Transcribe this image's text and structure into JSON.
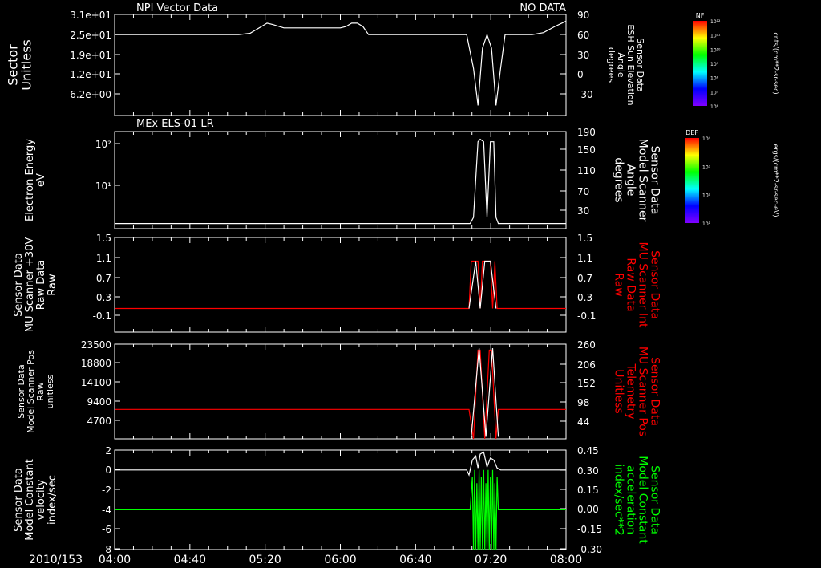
{
  "page": {
    "date_label": "2010/153",
    "time_ticks": [
      "04:00",
      "04:40",
      "05:20",
      "06:00",
      "06:40",
      "07:20",
      "08:00"
    ],
    "time_range_hours": [
      4.0,
      8.0
    ]
  },
  "colors": {
    "background": "#000000",
    "axis": "#ffffff",
    "trace_white": "#ffffff",
    "trace_red": "#ff0000",
    "trace_green": "#00ff00"
  },
  "colorbars": [
    {
      "name": "NF",
      "units": "cnts/(cm**2-sr-sec)",
      "ticks": [
        "10¹²",
        "10¹¹",
        "10¹⁰",
        "10⁹",
        "10⁸",
        "10⁷",
        "10⁶"
      ]
    },
    {
      "name": "DEF",
      "units": "ergs/(cm**2-sr-sec-eV)",
      "ticks": [
        "10⁴",
        "10³",
        "10²",
        "10¹"
      ]
    }
  ],
  "chart_data": [
    {
      "type": "line",
      "header_left": "NPI Vector Data",
      "header_right": "NO DATA",
      "ylabel": [
        "Sector",
        "Unitless"
      ],
      "yticks_left": [
        "3.1e+01",
        "2.5e+01",
        "1.9e+01",
        "1.2e+01",
        "6.2e+00"
      ],
      "right_label_color": "#ffffff",
      "ylabel_right": [
        "Sensor Data",
        "ESH Sun Elevation",
        "Angle",
        "degrees"
      ],
      "yticks_right": [
        "90",
        "60",
        "30",
        "0",
        "-30"
      ],
      "ylim_right": [
        -60,
        90
      ],
      "series": [
        {
          "color": "#ffffff",
          "x": [
            4.0,
            5.0,
            5.1,
            5.2,
            5.3,
            5.35,
            5.4,
            5.5,
            5.75,
            5.8,
            5.9,
            6.0,
            6.05,
            6.1,
            6.15,
            6.2,
            6.25,
            7.0,
            7.12,
            7.18,
            7.22,
            7.26,
            7.3,
            7.34,
            7.38,
            7.42,
            7.46,
            7.5,
            7.7,
            7.8,
            7.9,
            8.0
          ],
          "y": [
            60,
            60,
            60,
            62,
            72,
            77,
            75,
            70,
            70,
            70,
            70,
            70,
            72,
            77,
            77,
            72,
            60,
            60,
            60,
            10,
            -45,
            40,
            60,
            40,
            -45,
            10,
            60,
            60,
            60,
            63,
            72,
            80
          ]
        }
      ]
    },
    {
      "type": "line",
      "header_left": "MEx ELS-01 LR",
      "ylabel": [
        "Electron Energy",
        "eV"
      ],
      "yticks_left": [
        "10²",
        "10¹"
      ],
      "right_label_color": "#ffffff",
      "ylabel_right": [
        "Sensor Data",
        "Model Scanner",
        "Angle",
        "degrees"
      ],
      "yticks_right": [
        "190",
        "150",
        "110",
        "70",
        "30"
      ],
      "ylim_right": [
        10,
        190
      ],
      "series": [
        {
          "color": "#ffffff",
          "x": [
            4.0,
            7.15,
            7.18,
            7.22,
            7.24,
            7.27,
            7.3,
            7.33,
            7.36,
            7.38,
            7.4,
            8.0
          ],
          "y": [
            10,
            10,
            22,
            170,
            175,
            170,
            22,
            170,
            170,
            22,
            10,
            10
          ]
        }
      ]
    },
    {
      "type": "line",
      "ylabel": [
        "Sensor Data",
        "MU Scanner +30V",
        "Raw Data",
        "Raw"
      ],
      "yticks_left": [
        "1.5",
        "1.1",
        "0.7",
        "0.3",
        "-0.1"
      ],
      "ylim_left": [
        -0.5,
        1.5
      ],
      "right_label_color": "#ff0000",
      "ylabel_right": [
        "Sensor Data",
        "MU Scanner Int",
        "Raw Data",
        "Raw"
      ],
      "yticks_right": [
        "1.5",
        "1.1",
        "0.7",
        "0.3",
        "-0.1"
      ],
      "series": [
        {
          "color": "#ff0000",
          "x": [
            4.0,
            7.14,
            7.16,
            7.22,
            7.24,
            7.26,
            7.28,
            7.33,
            7.35,
            7.37,
            7.39,
            8.0
          ],
          "y": [
            0.0,
            0.0,
            1.0,
            1.0,
            0.0,
            1.0,
            1.0,
            1.0,
            0.0,
            1.0,
            0.0,
            0.0
          ]
        },
        {
          "color": "#ffffff",
          "x": [
            7.14,
            7.2,
            7.24,
            7.28,
            7.33,
            7.38
          ],
          "y": [
            0.0,
            1.0,
            0.0,
            1.0,
            1.0,
            0.0
          ]
        }
      ]
    },
    {
      "type": "line",
      "ylabel": [
        "Sensor Data",
        "Model Scanner Pos",
        "Raw",
        "unitless"
      ],
      "yticks_left": [
        "23500",
        "18800",
        "14100",
        "9400",
        "4700"
      ],
      "ylim_left": [
        0,
        23500
      ],
      "right_label_color": "#ff0000",
      "ylabel_right": [
        "Sensor Data",
        "MU Scanner Pos",
        "Telemetry",
        "Unitless"
      ],
      "yticks_right": [
        "260",
        "206",
        "152",
        "98",
        "44"
      ],
      "series": [
        {
          "color": "#ff0000",
          "x": [
            4.0,
            7.14,
            7.18,
            7.22,
            7.24,
            7.28,
            7.32,
            7.34,
            7.38,
            7.4,
            8.0
          ],
          "y": [
            7300,
            7300,
            0,
            22000,
            22000,
            0,
            22000,
            22000,
            0,
            7300,
            7300
          ]
        },
        {
          "color": "#ffffff",
          "x": [
            7.16,
            7.23,
            7.29,
            7.35,
            7.4
          ],
          "y": [
            500,
            22500,
            500,
            22500,
            500
          ]
        }
      ]
    },
    {
      "type": "line",
      "ylabel": [
        "Sensor Data",
        "Model Constant",
        "velocity",
        "index/sec"
      ],
      "yticks_left": [
        "2",
        "0",
        "-2",
        "-4",
        "-6",
        "-8"
      ],
      "ylim_left": [
        -8,
        2
      ],
      "right_label_color": "#00ff00",
      "ylabel_right": [
        "Sensor Data",
        "Model Constant",
        "acceleration",
        "index/sec**2"
      ],
      "yticks_right": [
        "0.45",
        "0.30",
        "0.15",
        "0.00",
        "-0.15",
        "-0.30"
      ],
      "ylim_right": [
        -0.3,
        0.45
      ],
      "series": [
        {
          "color": "#ffffff",
          "axis": "left",
          "x": [
            4.0,
            7.12,
            7.14,
            7.17,
            7.2,
            7.22,
            7.24,
            7.27,
            7.3,
            7.33,
            7.36,
            7.39,
            7.42,
            7.44,
            8.0
          ],
          "y": [
            0,
            0,
            -0.5,
            1.0,
            1.4,
            0.2,
            1.6,
            1.8,
            0.3,
            1.2,
            1.0,
            0.2,
            0.0,
            0.0,
            0
          ]
        },
        {
          "color": "#00ff00",
          "axis": "right",
          "x": [
            4.0,
            7.15,
            7.17,
            7.18,
            7.19,
            7.2,
            7.21,
            7.22,
            7.23,
            7.24,
            7.25,
            7.26,
            7.27,
            7.28,
            7.29,
            7.3,
            7.31,
            7.32,
            7.33,
            7.34,
            7.35,
            7.36,
            7.37,
            7.38,
            7.39,
            7.4,
            8.0
          ],
          "y": [
            0,
            0,
            0.25,
            -0.3,
            0.3,
            -0.3,
            0.2,
            -0.3,
            0.3,
            -0.3,
            0.25,
            -0.3,
            0.3,
            -0.3,
            0.2,
            -0.3,
            0.3,
            -0.3,
            0.25,
            -0.3,
            0.3,
            -0.3,
            0.2,
            -0.3,
            0.25,
            0,
            0
          ]
        }
      ]
    }
  ]
}
